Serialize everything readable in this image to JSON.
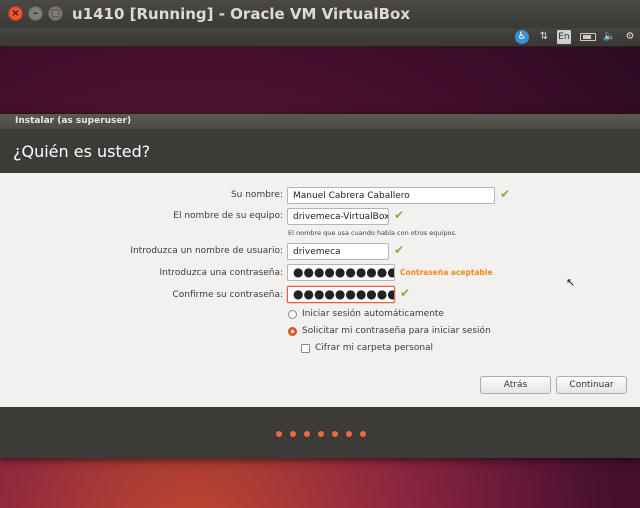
{
  "window": {
    "title": "u1410 [Running] - Oracle VM VirtualBox",
    "close_glyph": "×",
    "min_glyph": "–",
    "max_glyph": "□"
  },
  "panel": {
    "keyboard_layout": "En",
    "accessibility_glyph": "♿",
    "network_glyph": "⇅",
    "volume_glyph": "🔈",
    "gear_glyph": "⚙"
  },
  "installer": {
    "title": "Instalar (as superuser)",
    "heading": "¿Quién es usted?",
    "fields": {
      "name": {
        "label": "Su nombre:",
        "value": "Manuel Cabrera Caballero"
      },
      "computer": {
        "label": "El nombre de su equipo:",
        "value": "drivemeca-VirtualBox",
        "hint": "El nombre que usa cuando habla con otros equipos."
      },
      "username": {
        "label": "Introduzca un nombre de usuario:",
        "value": "drivemeca"
      },
      "password": {
        "label": "Introduzca una contraseña:",
        "value": "●●●●●●●●●●●",
        "strength": "Contraseña aceptable"
      },
      "confirm": {
        "label": "Confirme su contraseña:",
        "value": "●●●●●●●●●●●"
      }
    },
    "check_glyph": "✔",
    "options": {
      "auto_login": {
        "label": "Iniciar sesión automáticamente",
        "selected": false
      },
      "require_password": {
        "label": "Solicitar mi contraseña para iniciar sesión",
        "selected": true
      },
      "encrypt_home": {
        "label": "Cifrar mi carpeta personal",
        "checked": false
      }
    },
    "buttons": {
      "back": "Atrás",
      "continue": "Continuar"
    },
    "progress": {
      "steps_total": 7,
      "accent": "#e96d3d"
    }
  },
  "colors": {
    "accent": "#e6603b",
    "ok": "#7fb536",
    "strength": "#ee8a1b",
    "header_bg": "#3c3b37"
  }
}
